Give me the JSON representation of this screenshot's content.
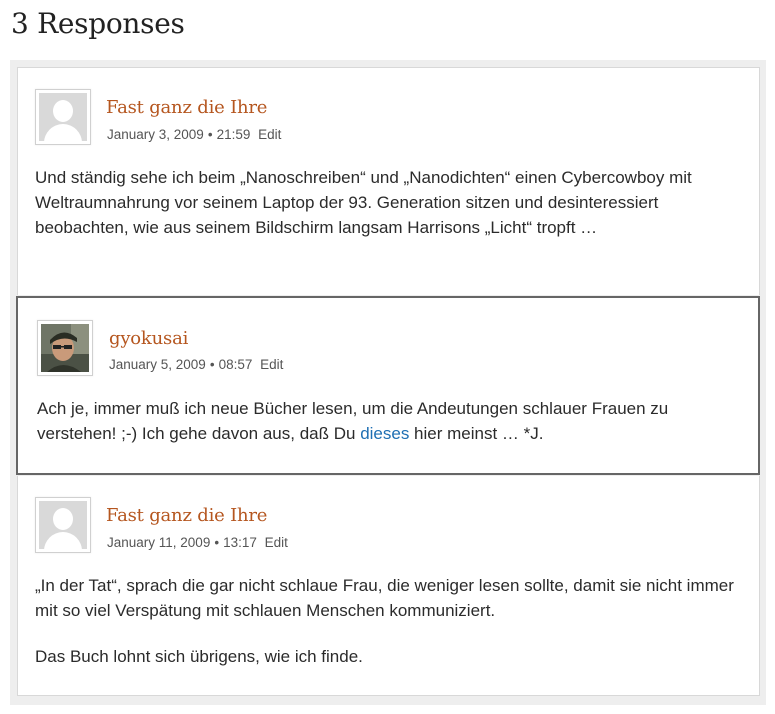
{
  "heading": "3 Responses",
  "comments": [
    {
      "author": "Fast ganz die Ihre",
      "date": "January 3, 2009",
      "time": "21:59",
      "edit_label": "Edit",
      "paragraphs": [
        "Und ständig sehe ich beim „Nanoschreiben“ und „Nanodichten“ einen Cybercowboy mit Weltraumnahrung vor seinem Laptop der 93. Generation sitzen und desinteressiert beobachten, wie aus seinem Bildschirm langsam Harrisons „Licht“ tropft …"
      ]
    },
    {
      "author": "gyokusai",
      "date": "January 5, 2009",
      "time": "08:57",
      "edit_label": "Edit",
      "text_before_link": "Ach je, immer muß ich neue Bücher lesen, um die Andeutungen schlauer Frauen zu verstehen! ;-) Ich gehe davon aus, daß Du ",
      "link_text": "dieses",
      "text_after_link": " hier meinst … *J."
    },
    {
      "author": "Fast ganz die Ihre",
      "date": "January 11, 2009",
      "time": "13:17",
      "edit_label": "Edit",
      "paragraphs": [
        "„In der Tat“, sprach die gar nicht schlaue Frau, die weniger lesen sollte, damit sie nicht immer mit so viel Verspätung mit schlauen Menschen kommuniziert.",
        "Das Buch lohnt sich übrigens, wie ich finde."
      ]
    }
  ],
  "separator": "•",
  "colors": {
    "author": "#b5561f",
    "link": "#1e6fb3",
    "highlight_border": "#666666"
  }
}
